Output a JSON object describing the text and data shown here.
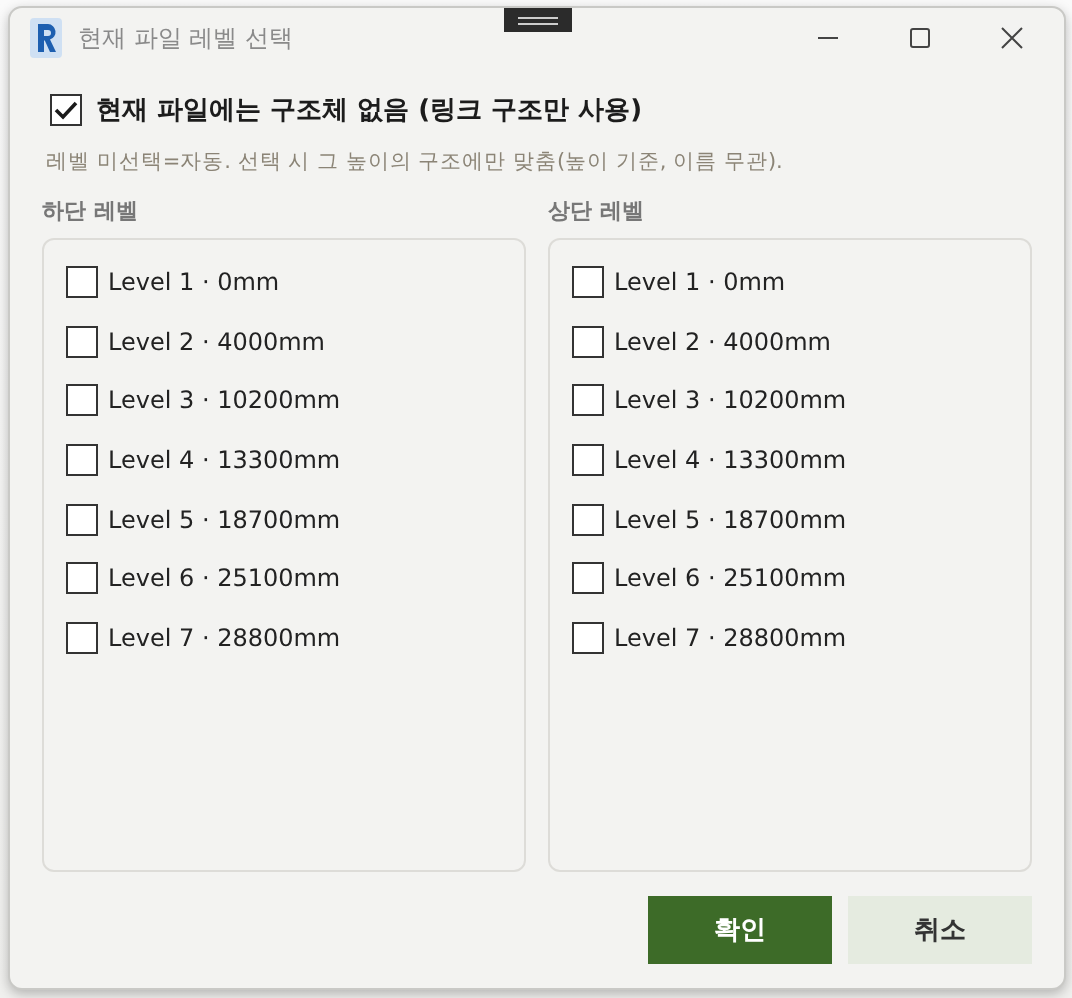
{
  "window": {
    "title": "현재 파일 레벨 선택"
  },
  "structure_option": {
    "label": "현재 파일에는 구조체 없음 (링크 구조만 사용)",
    "checked": true
  },
  "hint": "레벨 미선택=자동. 선택 시 그 높이의 구조에만 맞춤(높이 기준, 이름 무관).",
  "panels": [
    {
      "title": "하단 레벨",
      "levels": [
        {
          "label": "Level 1 · 0mm",
          "checked": false
        },
        {
          "label": "Level 2 · 4000mm",
          "checked": false
        },
        {
          "label": "Level 3 · 10200mm",
          "checked": false
        },
        {
          "label": "Level 4 · 13300mm",
          "checked": false
        },
        {
          "label": "Level 5 · 18700mm",
          "checked": false
        },
        {
          "label": "Level 6 · 25100mm",
          "checked": false
        },
        {
          "label": "Level 7 · 28800mm",
          "checked": false
        }
      ]
    },
    {
      "title": "상단 레벨",
      "levels": [
        {
          "label": "Level 1 · 0mm",
          "checked": false
        },
        {
          "label": "Level 2 · 4000mm",
          "checked": false
        },
        {
          "label": "Level 3 · 10200mm",
          "checked": false
        },
        {
          "label": "Level 4 · 13300mm",
          "checked": false
        },
        {
          "label": "Level 5 · 18700mm",
          "checked": false
        },
        {
          "label": "Level 6 · 25100mm",
          "checked": false
        },
        {
          "label": "Level 7 · 28800mm",
          "checked": false
        }
      ]
    }
  ],
  "buttons": [
    {
      "label": "확인",
      "kind": "primary"
    },
    {
      "label": "취소",
      "kind": "secondary"
    }
  ]
}
